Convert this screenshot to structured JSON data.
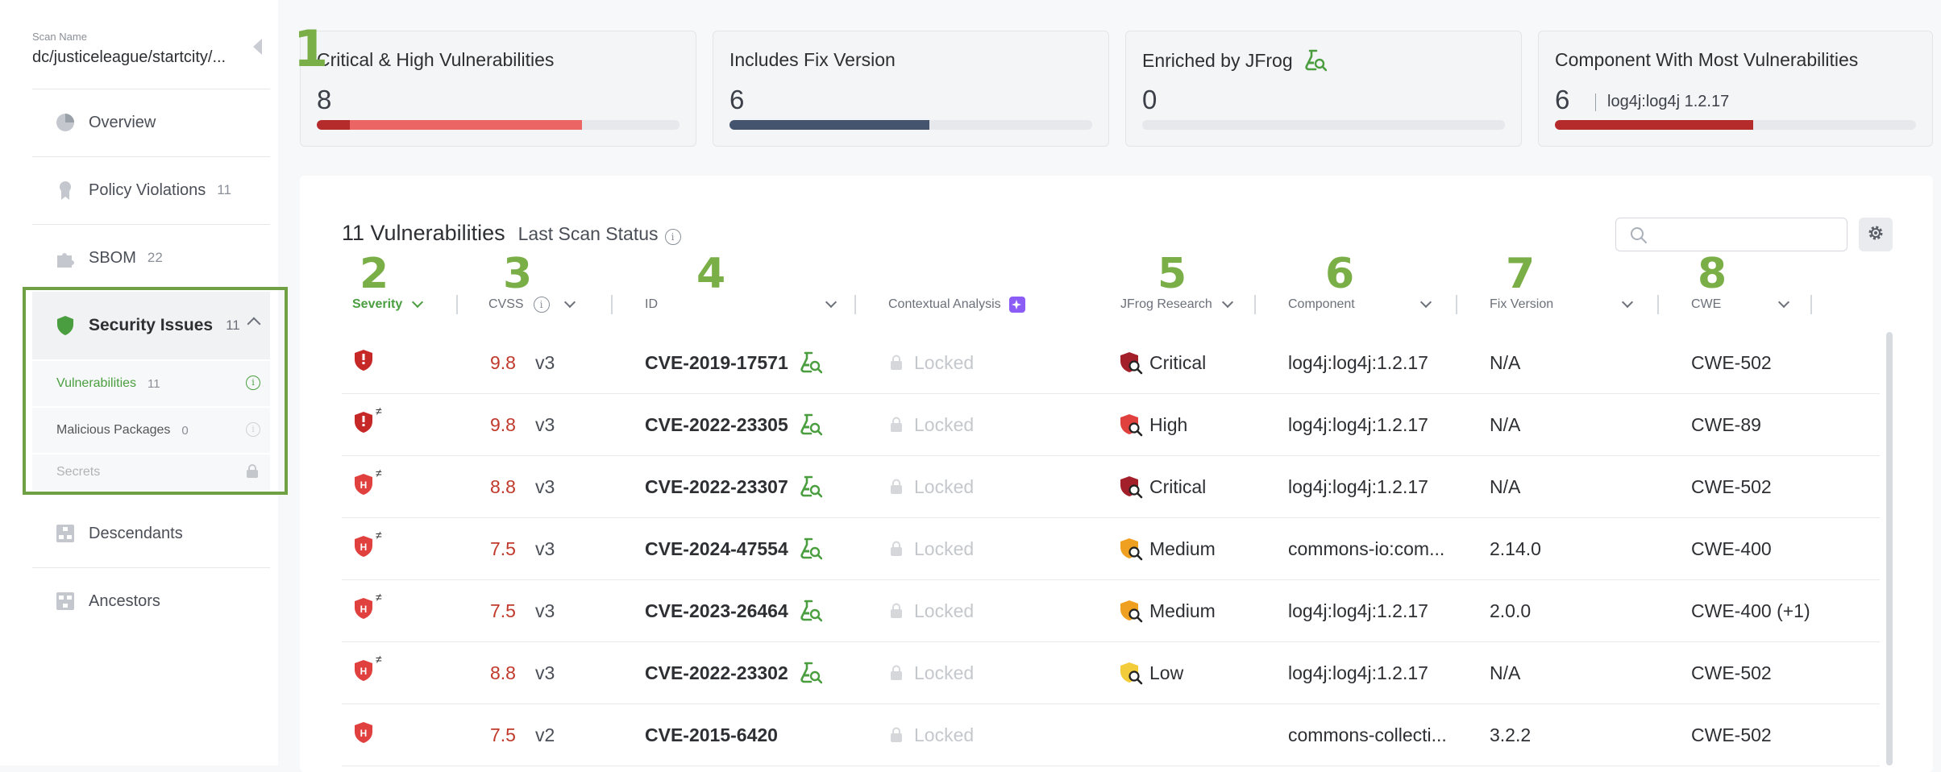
{
  "sidebar": {
    "scan_label": "Scan Name",
    "scan_name": "dc/justiceleague/startcity/...",
    "items": [
      {
        "label": "Overview",
        "count": "",
        "icon": "pie-chart-icon"
      },
      {
        "label": "Policy Violations",
        "count": "11",
        "icon": "ribbon-icon"
      },
      {
        "label": "SBOM",
        "count": "22",
        "icon": "puzzle-icon"
      }
    ],
    "security": {
      "label": "Security Issues",
      "count": "11",
      "icon": "shield-icon"
    },
    "sub_items": [
      {
        "label": "Vulnerabilities",
        "count": "11"
      },
      {
        "label": "Malicious Packages",
        "count": "0"
      },
      {
        "label": "Secrets",
        "count": ""
      }
    ],
    "bottom_items": [
      {
        "label": "Descendants",
        "icon": "descendants-icon"
      },
      {
        "label": "Ancestors",
        "icon": "ancestors-icon"
      }
    ]
  },
  "cards": [
    {
      "title": "Critical & High Vulnerabilities",
      "value": "8",
      "segments": [
        {
          "fraction": 0.09,
          "color": "#b52a2a"
        },
        {
          "fraction": 0.64,
          "color": "#ec6565"
        }
      ]
    },
    {
      "title": "Includes Fix Version",
      "value": "6",
      "segments": [
        {
          "fraction": 0.55,
          "color": "#44546f"
        }
      ]
    },
    {
      "title": "Enriched by JFrog",
      "value": "0",
      "segments": []
    },
    {
      "title": "Component With Most Vulnerabilities",
      "value": "6",
      "component": "log4j:log4j 1.2.17",
      "segments": [
        {
          "fraction": 0.55,
          "color": "#b52a2a"
        }
      ]
    }
  ],
  "annotations": [
    "1",
    "2",
    "3",
    "4",
    "5",
    "6",
    "7",
    "8"
  ],
  "table": {
    "title": "11 Vulnerabilities",
    "subtitle": "Last Scan Status",
    "search_placeholder": "",
    "columns": [
      "Severity",
      "CVSS",
      "ID",
      "Contextual Analysis",
      "JFrog Research",
      "Component",
      "Fix Version",
      "CWE"
    ],
    "rows": [
      {
        "severity": "critical",
        "applicable": false,
        "cvss": "9.8",
        "cvss_ver": "v3",
        "id": "CVE-2019-17571",
        "jfrog_icon": true,
        "contextual": "Locked",
        "research": "Critical",
        "research_color": "#a3202a",
        "component": "log4j:log4j:1.2.17",
        "fix": "N/A",
        "cwe": "CWE-502"
      },
      {
        "severity": "critical",
        "applicable": true,
        "cvss": "9.8",
        "cvss_ver": "v3",
        "id": "CVE-2022-23305",
        "jfrog_icon": true,
        "contextual": "Locked",
        "research": "High",
        "research_color": "#e0413f",
        "component": "log4j:log4j:1.2.17",
        "fix": "N/A",
        "cwe": "CWE-89"
      },
      {
        "severity": "high",
        "applicable": true,
        "cvss": "8.8",
        "cvss_ver": "v3",
        "id": "CVE-2022-23307",
        "jfrog_icon": true,
        "contextual": "Locked",
        "research": "Critical",
        "research_color": "#a3202a",
        "component": "log4j:log4j:1.2.17",
        "fix": "N/A",
        "cwe": "CWE-502"
      },
      {
        "severity": "high",
        "applicable": true,
        "cvss": "7.5",
        "cvss_ver": "v3",
        "id": "CVE-2024-47554",
        "jfrog_icon": true,
        "contextual": "Locked",
        "research": "Medium",
        "research_color": "#f0a020",
        "component": "commons-io:com...",
        "fix": "2.14.0",
        "cwe": "CWE-400"
      },
      {
        "severity": "high",
        "applicable": true,
        "cvss": "7.5",
        "cvss_ver": "v3",
        "id": "CVE-2023-26464",
        "jfrog_icon": true,
        "contextual": "Locked",
        "research": "Medium",
        "research_color": "#f0a020",
        "component": "log4j:log4j:1.2.17",
        "fix": "2.0.0",
        "cwe": "CWE-400 (+1)"
      },
      {
        "severity": "high",
        "applicable": true,
        "cvss": "8.8",
        "cvss_ver": "v3",
        "id": "CVE-2022-23302",
        "jfrog_icon": true,
        "contextual": "Locked",
        "research": "Low",
        "research_color": "#f2cc3a",
        "component": "log4j:log4j:1.2.17",
        "fix": "N/A",
        "cwe": "CWE-502"
      },
      {
        "severity": "high",
        "applicable": false,
        "cvss": "7.5",
        "cvss_ver": "v2",
        "id": "CVE-2015-6420",
        "jfrog_icon": false,
        "contextual": "Locked",
        "research": "",
        "research_color": "",
        "component": "commons-collecti...",
        "fix": "3.2.2",
        "cwe": "CWE-502"
      }
    ]
  },
  "colors": {
    "accent_green": "#4a9e3f",
    "annotation_green": "#7aae46",
    "critical": "#c62828",
    "high": "#e0413f"
  }
}
